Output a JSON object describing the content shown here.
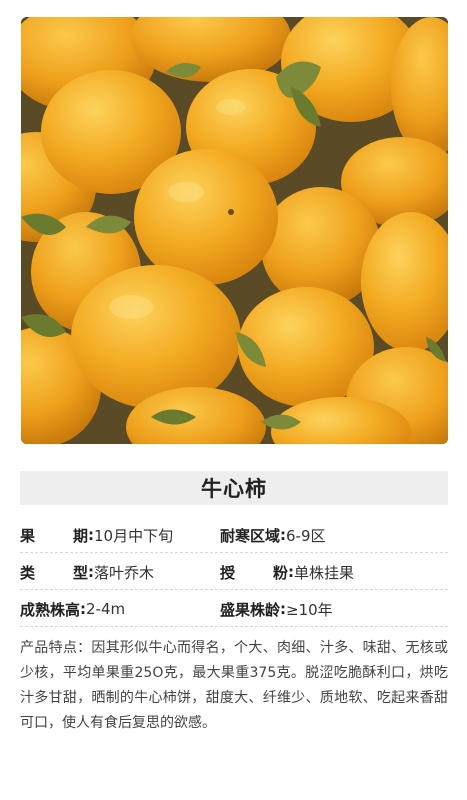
{
  "title": "牛心柿",
  "specs": [
    {
      "l1a": "果",
      "l1b": "期",
      "v1": "10月中下旬",
      "l2": "耐寒区域",
      "v2": "6-9区"
    },
    {
      "l1a": "类",
      "l1b": "型",
      "v1": "落叶乔木",
      "l2a": "授",
      "l2b": "粉",
      "v2": "单株挂果"
    },
    {
      "l1": "成熟株高",
      "v1": "2-4m",
      "l2": "盛果株龄",
      "v2": "≥10年"
    }
  ],
  "description": "产品特点：因其形似牛心而得名，个大、肉细、汁多、味甜、无核或少核，平均单果重25O克，最大果重375克。脱涩吃脆酥利口，烘吃汁多甘甜，晒制的牛心柿饼，甜度大、纤维少、质地软、吃起来香甜可口，使人有食后复思的欲感。",
  "colors": {
    "fruit": "#f2a41c",
    "fruit_light": "#fbc84a",
    "leaf": "#7c8a3a",
    "title_bg": "#eeeeee"
  }
}
